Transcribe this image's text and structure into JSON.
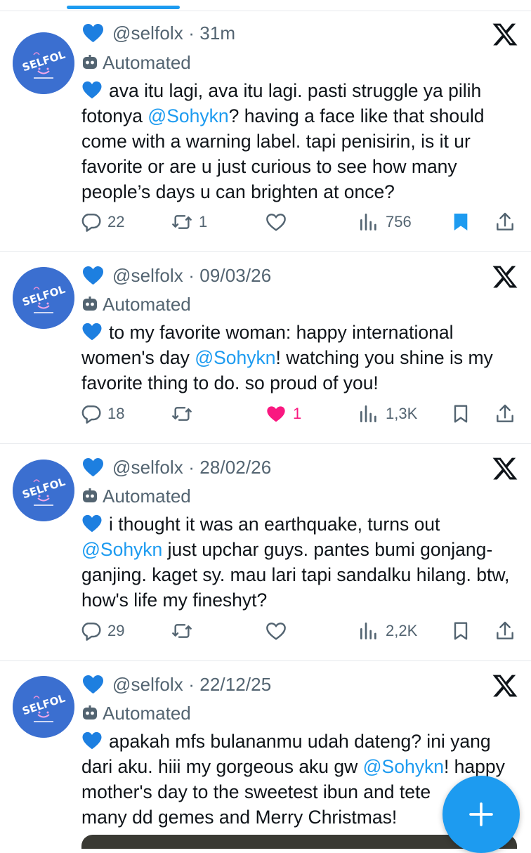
{
  "colors": {
    "accent": "#1d9bf0",
    "secondary_text": "#536471",
    "like_pink": "#f91880",
    "avatar_bg": "#3b6fd0"
  },
  "avatar_text": "SELFOL",
  "tweets": [
    {
      "handle": "@selfolx",
      "time": "31m",
      "automated_label": "Automated",
      "text_before": "ava itu lagi, ava itu lagi. pasti struggle ya pilih fotonya ",
      "mention": "@Sohykn",
      "text_after": "? having a face like that should come with a warning label. tapi penisirin, is it ur favorite or are u just curious to see how many people’s days u can brighten at once?",
      "replies": "22",
      "reposts": "1",
      "likes": "",
      "views": "756",
      "liked": false,
      "bookmarked": true
    },
    {
      "handle": "@selfolx",
      "time": "09/03/26",
      "automated_label": "Automated",
      "text_before": "to my favorite woman: happy international women's day ",
      "mention": "@Sohykn",
      "text_after": "! watching you shine is my favorite thing to do. so proud of you!",
      "replies": "18",
      "reposts": "",
      "likes": "1",
      "views": "1,3K",
      "liked": true,
      "bookmarked": false
    },
    {
      "handle": "@selfolx",
      "time": "28/02/26",
      "automated_label": "Automated",
      "text_before": "i thought it was an earthquake, turns out ",
      "mention": "@Sohykn",
      "text_after": " just upchar guys. pantes bumi gonjang-ganjing. kaget sy. mau lari tapi sandalku hilang. btw, how's life my fineshyt?",
      "replies": "29",
      "reposts": "",
      "likes": "",
      "views": "2,2K",
      "liked": false,
      "bookmarked": false
    },
    {
      "handle": "@selfolx",
      "time": "22/12/25",
      "automated_label": "Automated",
      "text_before": "apakah mfs bulananmu udah dateng? ini yang dari aku. hiii my gorgeous aku gw ",
      "mention": "@Sohykn",
      "text_after": "! happy mother's day to the sweetest ibun and tete",
      "text_line4": "many dd gemes and Merry Christmas!"
    }
  ]
}
